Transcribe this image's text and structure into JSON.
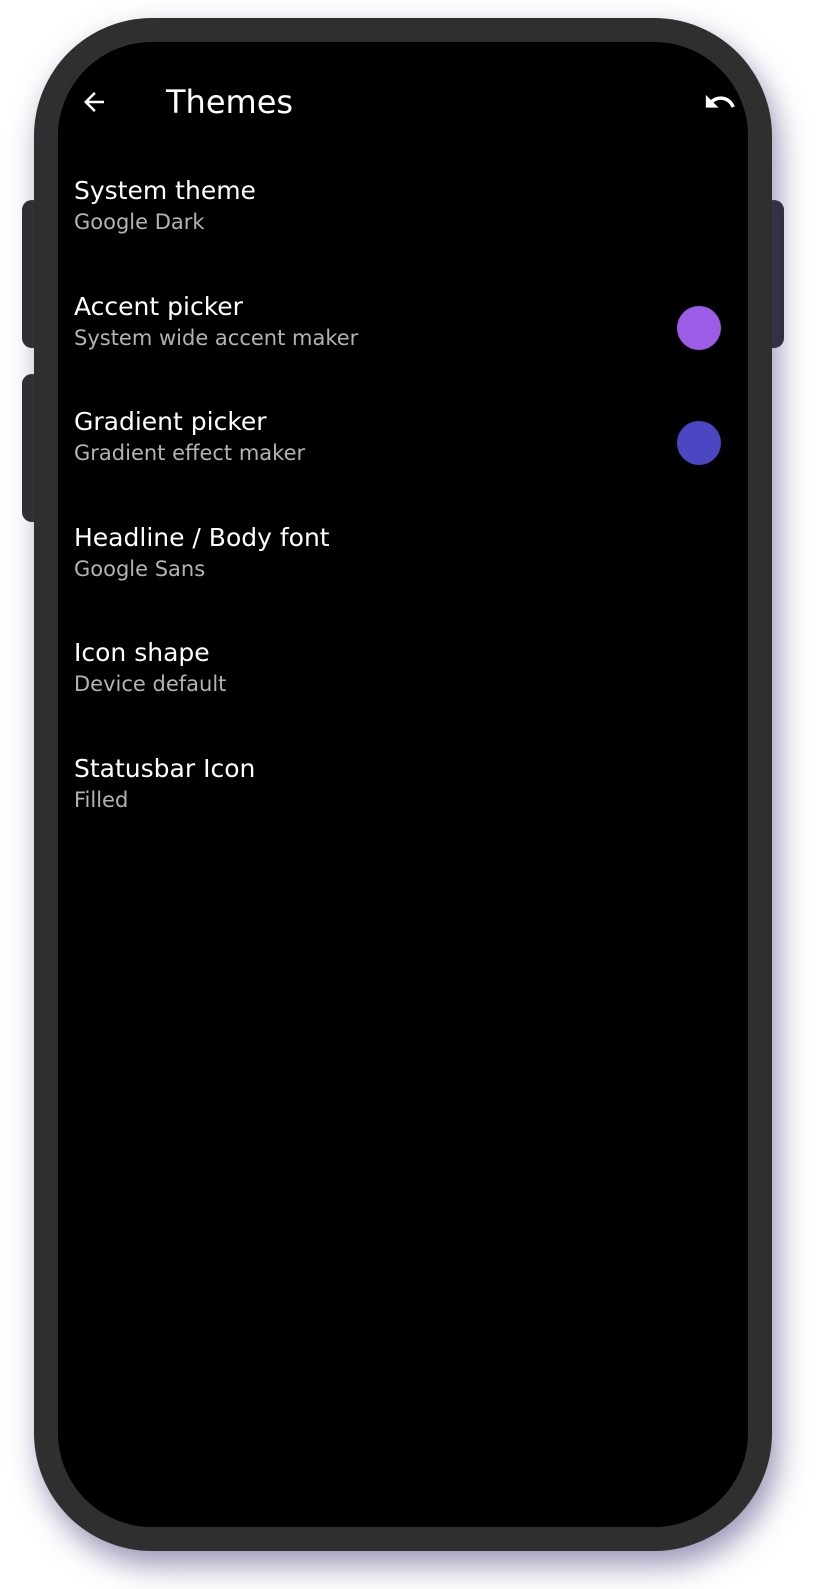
{
  "app_bar": {
    "title": "Themes",
    "back_icon": "arrow-left-icon",
    "reset_icon": "undo-icon"
  },
  "settings": [
    {
      "title": "System theme",
      "summary": "Google Dark"
    },
    {
      "title": "Accent picker",
      "summary": "System wide accent maker",
      "swatch_color": "#9d5ce8"
    },
    {
      "title": "Gradient picker",
      "summary": "Gradient effect maker",
      "swatch_color": "#4b47c3"
    },
    {
      "title": "Headline / Body font",
      "summary": "Google Sans"
    },
    {
      "title": "Icon shape",
      "summary": "Device default"
    },
    {
      "title": "Statusbar Icon",
      "summary": "Filled"
    }
  ],
  "colors": {
    "screen_background": "#000000",
    "frame": "#2f2f2f",
    "primary_text": "#ffffff",
    "secondary_text": "#b3b3b3"
  }
}
